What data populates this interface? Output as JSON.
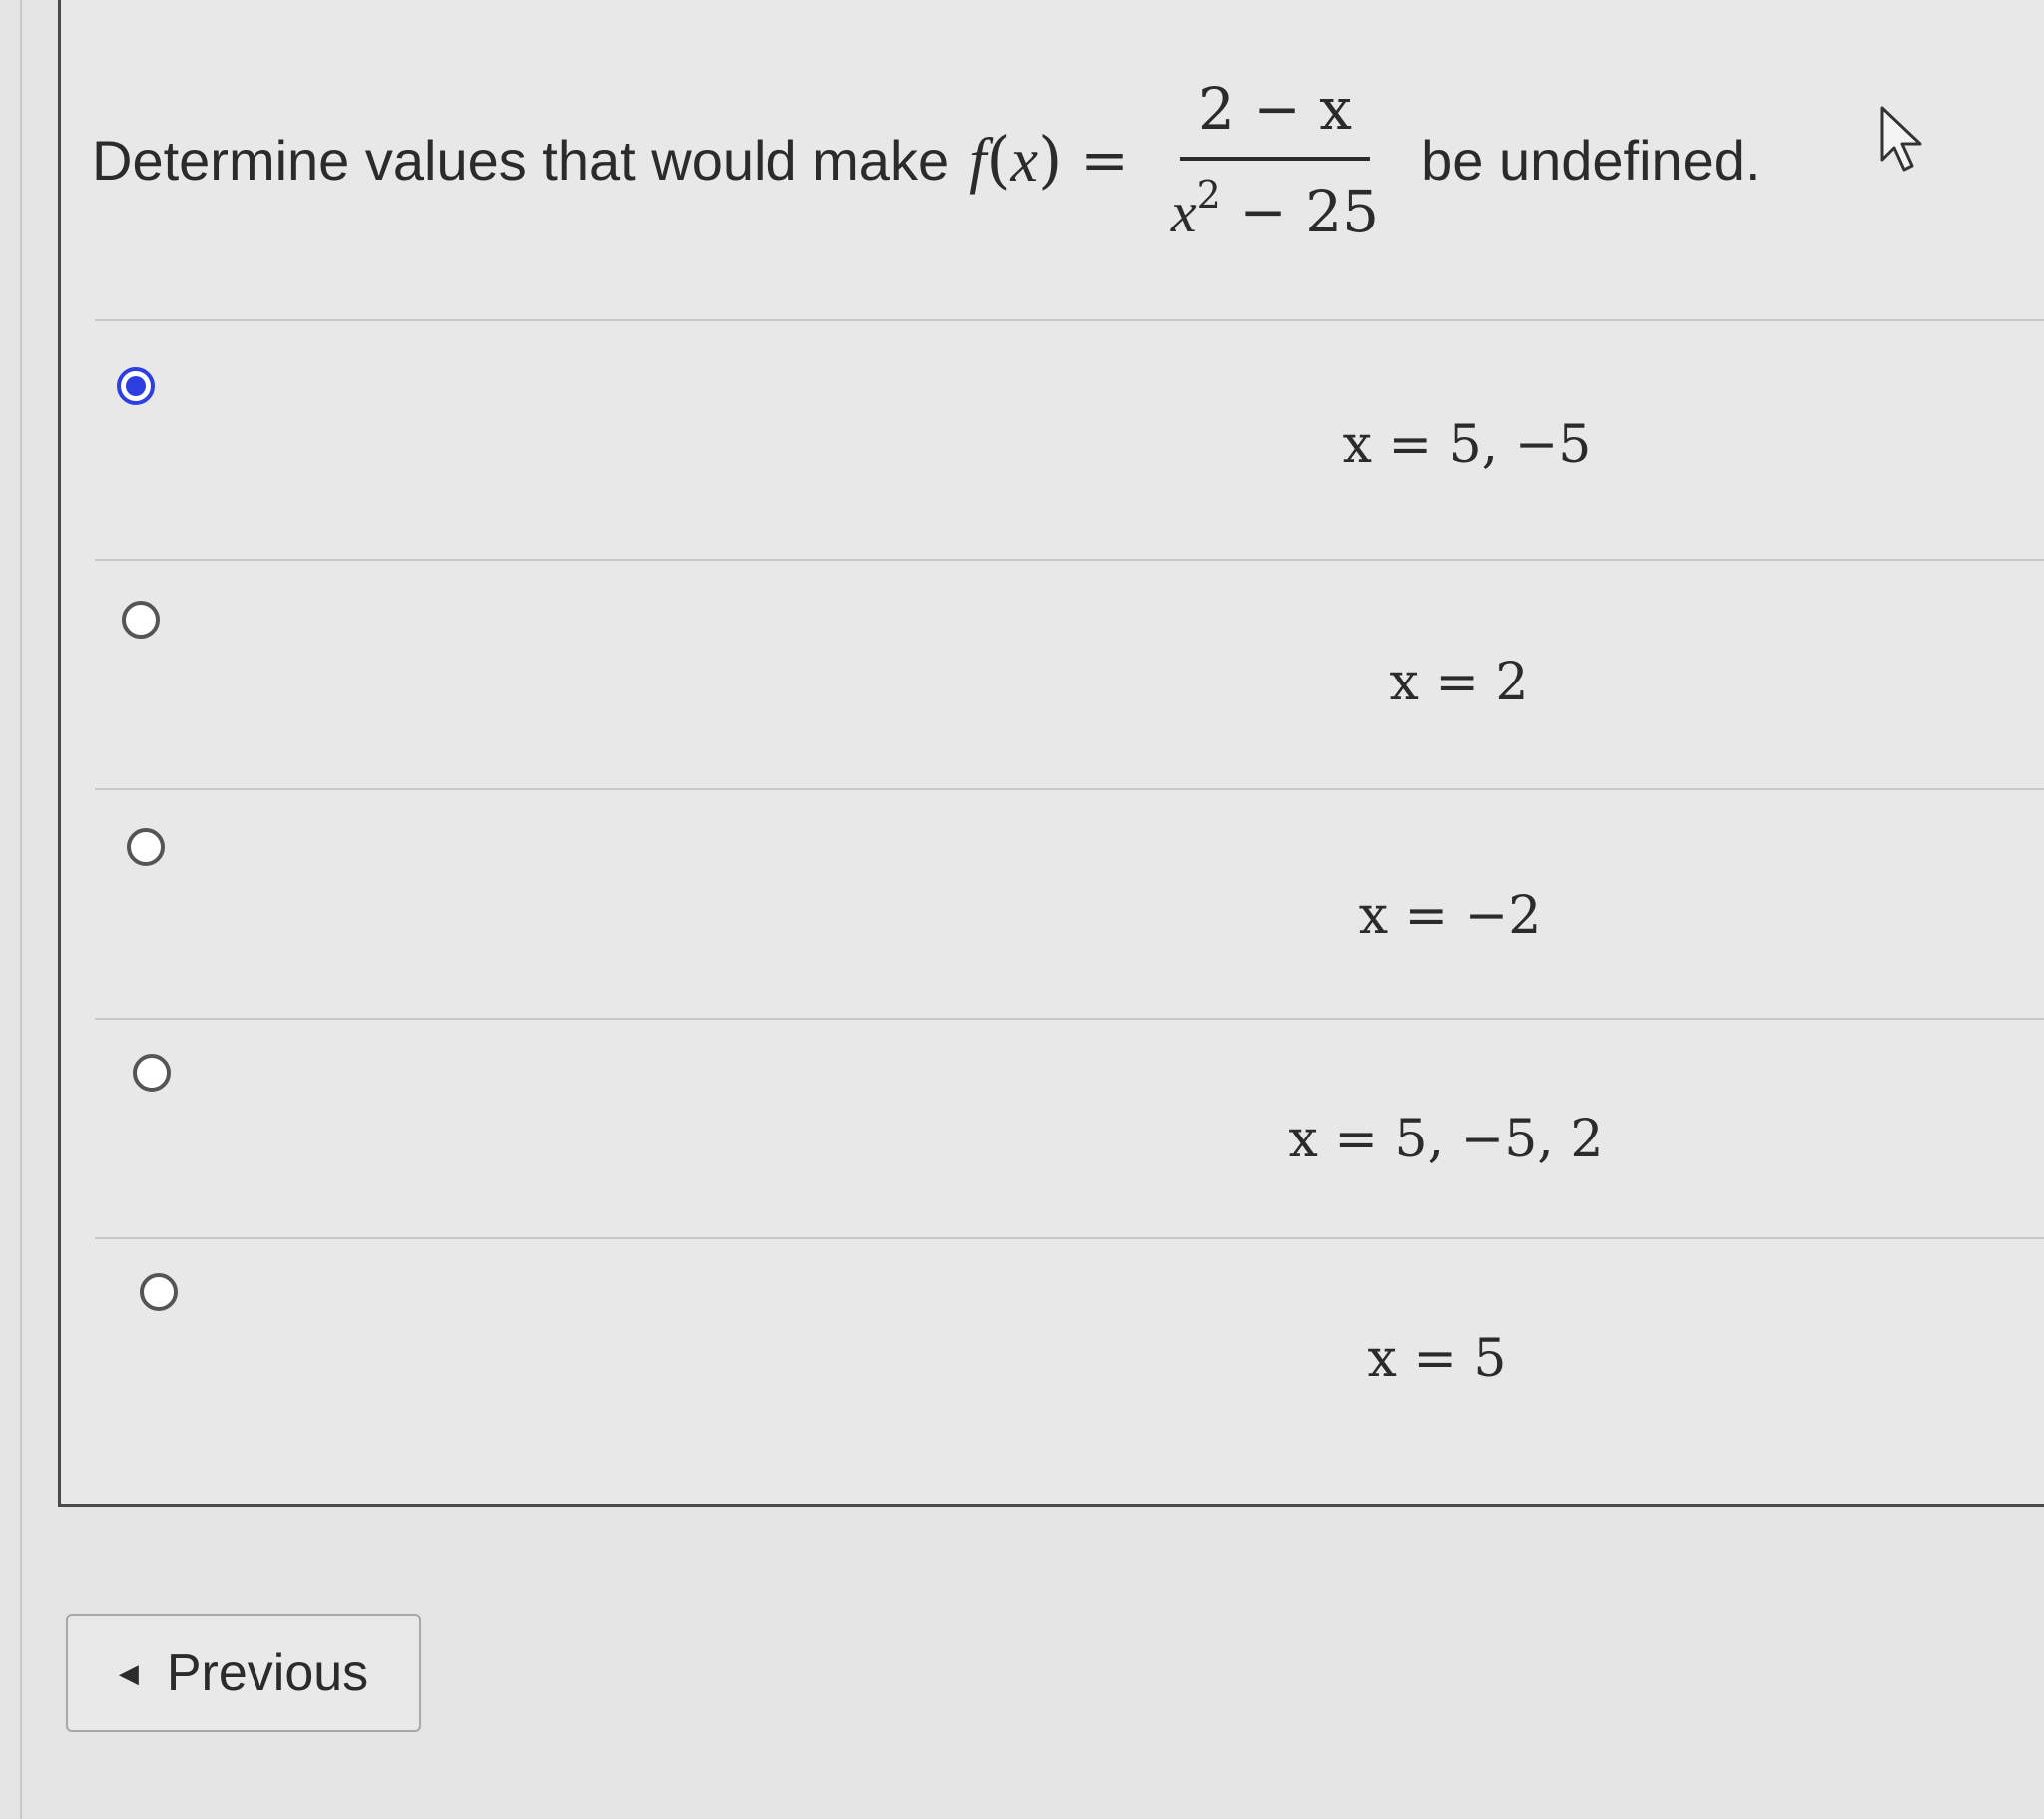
{
  "question": {
    "prefix": "Determine values that would make",
    "function_label_f": "f",
    "function_label_open": "(",
    "function_label_x": "x",
    "function_label_close": ")",
    "equals": "=",
    "numerator": "2 − x",
    "denominator_base": "x",
    "denominator_exp": "2",
    "denominator_rest": " − 25",
    "suffix": "be undefined."
  },
  "options": [
    {
      "label": "x = 5, −5",
      "selected": true
    },
    {
      "label": "x = 2",
      "selected": false
    },
    {
      "label": "x = −2",
      "selected": false
    },
    {
      "label": "x = 5, −5, 2",
      "selected": false
    },
    {
      "label": "x = 5",
      "selected": false
    }
  ],
  "navigation": {
    "previous_label": "Previous",
    "previous_icon": "caret-left-icon"
  },
  "cursor_icon": "pointer-arrow-icon",
  "colors": {
    "selected_radio": "#2d3fe0",
    "background": "#e8e8e8"
  }
}
